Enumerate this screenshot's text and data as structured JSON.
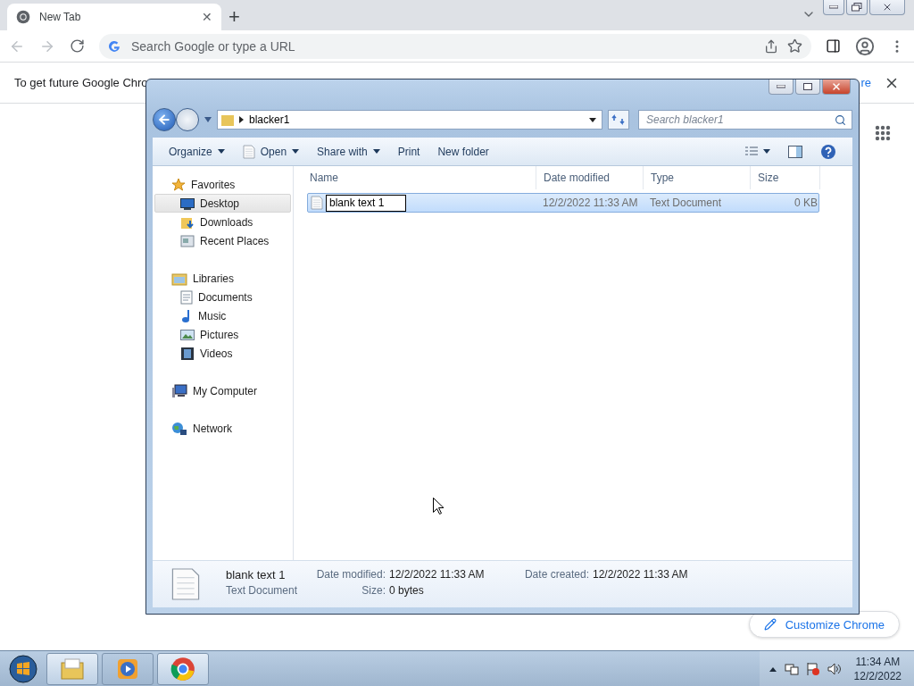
{
  "browser": {
    "tab": {
      "title": "New Tab",
      "close": "✕"
    },
    "new_tab": "+",
    "omnibox": {
      "placeholder": "Search Google or type a URL"
    },
    "infobar": {
      "text": "To get future Google Chro",
      "link": "re"
    },
    "customize_button": "Customize Chrome"
  },
  "explorer": {
    "address": {
      "path": "blacker1"
    },
    "search": {
      "placeholder": "Search blacker1"
    },
    "toolbar": [
      {
        "label": "Organize",
        "dropdown": true,
        "kind": "plain"
      },
      {
        "label": "Open",
        "dropdown": true,
        "kind": "notepad"
      },
      {
        "label": "Share with",
        "dropdown": true,
        "kind": "plain"
      },
      {
        "label": "Print",
        "dropdown": false,
        "kind": "plain"
      },
      {
        "label": "New folder",
        "dropdown": false,
        "kind": "plain"
      }
    ],
    "navigation": [
      {
        "label": "Favorites",
        "kind": "star",
        "children": [
          {
            "label": "Desktop",
            "kind": "desktop",
            "selected": true
          },
          {
            "label": "Downloads",
            "kind": "download",
            "selected": false
          },
          {
            "label": "Recent Places",
            "kind": "recent",
            "selected": false
          }
        ]
      },
      {
        "label": "Libraries",
        "kind": "library",
        "children": [
          {
            "label": "Documents",
            "kind": "document",
            "selected": false
          },
          {
            "label": "Music",
            "kind": "music",
            "selected": false
          },
          {
            "label": "Pictures",
            "kind": "pictures",
            "selected": false
          },
          {
            "label": "Videos",
            "kind": "video",
            "selected": false
          }
        ]
      },
      {
        "label": "My Computer",
        "kind": "computer"
      },
      {
        "label": "Network",
        "kind": "network"
      }
    ],
    "columns": [
      "Name",
      "Date modified",
      "Type",
      "Size"
    ],
    "rows": [
      {
        "name": "blank text 1",
        "date": "12/2/2022 11:33 AM",
        "type": "Text Document",
        "size": "0 KB",
        "selected": true,
        "renaming": true
      }
    ],
    "details": {
      "name": "blank text 1",
      "type": "Text Document",
      "fields": [
        {
          "label": "Date modified:",
          "value": "12/2/2022 11:33 AM"
        },
        {
          "label": "Date created:",
          "value": "12/2/2022 11:33 AM"
        },
        {
          "label": "Size:",
          "value": "0 bytes"
        }
      ]
    }
  },
  "taskbar": {
    "clock": {
      "time": "11:34 AM",
      "date": "12/2/2022"
    }
  }
}
